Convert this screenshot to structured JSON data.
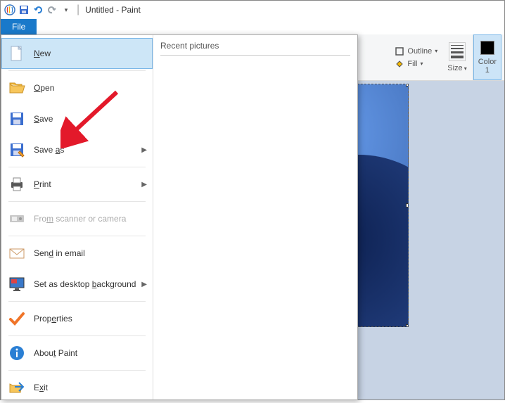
{
  "titlebar": {
    "title": "Untitled - Paint"
  },
  "tabs": {
    "file": "File"
  },
  "ribbon": {
    "outline": "Outline",
    "fill": "Fill",
    "size": "Size",
    "color1": "Color\n1"
  },
  "file_menu": {
    "recent_header": "Recent pictures",
    "items": {
      "new": "New",
      "open": "Open",
      "save": "Save",
      "save_as": "Save as",
      "print": "Print",
      "scanner": "From scanner or camera",
      "email": "Send in email",
      "desktop_bg": "Set as desktop background",
      "properties": "Properties",
      "about": "About Paint",
      "exit": "Exit"
    }
  }
}
